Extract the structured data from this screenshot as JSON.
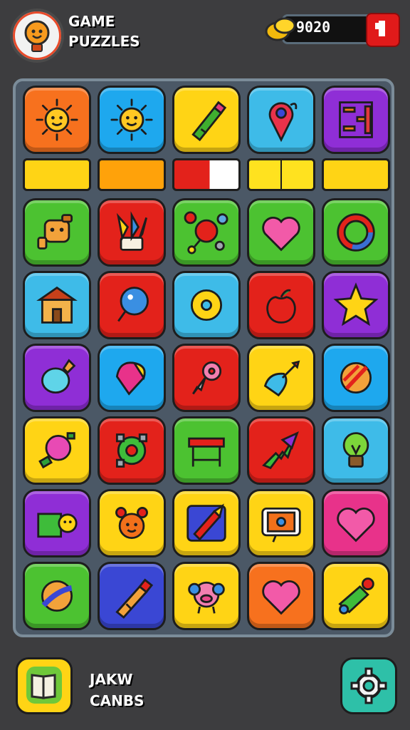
{
  "header": {
    "title_line1": "GAME",
    "title_line2": "PUZZLES",
    "coins": "9020",
    "logo_icon": "lightbulb-face-icon",
    "coin_icon": "gold-coins-icon",
    "add_icon": "plus-icon"
  },
  "colors": {
    "background": "#3d3d3f",
    "board": "#4b5866",
    "orange": "#f7711e",
    "blue": "#1ea8ee",
    "yellow": "#ffd415",
    "teal": "#3ebbe8",
    "purple": "#8f2ed6",
    "green": "#4cc231",
    "red": "#e3221b",
    "pink": "#e8328a",
    "royal": "#3a47d4"
  },
  "strips": [
    "yellow",
    "orange",
    "red-white",
    "yellow-split",
    "yellow"
  ],
  "rows": [
    [
      {
        "bg": "orange",
        "icon": "sun-icon"
      },
      {
        "bg": "blue",
        "icon": "sun-icon"
      },
      {
        "bg": "yellow",
        "icon": "paint-tube-icon"
      },
      {
        "bg": "teal",
        "icon": "map-pin-icon"
      },
      {
        "bg": "purple",
        "icon": "abacus-icon"
      }
    ],
    [
      {
        "bg": "green",
        "icon": "robot-icon"
      },
      {
        "bg": "red",
        "icon": "paintbrushes-icon"
      },
      {
        "bg": "green",
        "icon": "molecule-icon"
      },
      {
        "bg": "green",
        "icon": "heart-icon"
      },
      {
        "bg": "green",
        "icon": "ring-icon"
      }
    ],
    [
      {
        "bg": "teal",
        "icon": "house-icon"
      },
      {
        "bg": "red",
        "icon": "balloon-icon"
      },
      {
        "bg": "teal",
        "icon": "donut-icon"
      },
      {
        "bg": "red",
        "icon": "apple-icon"
      },
      {
        "bg": "purple",
        "icon": "star-icon"
      }
    ],
    [
      {
        "bg": "purple",
        "icon": "potion-icon"
      },
      {
        "bg": "blue",
        "icon": "kite-icon"
      },
      {
        "bg": "red",
        "icon": "key-icon"
      },
      {
        "bg": "yellow",
        "icon": "dart-icon"
      },
      {
        "bg": "blue",
        "icon": "striped-ball-icon"
      }
    ],
    [
      {
        "bg": "yellow",
        "icon": "candy-icon"
      },
      {
        "bg": "red",
        "icon": "gear-ring-icon"
      },
      {
        "bg": "green",
        "icon": "table-icon"
      },
      {
        "bg": "red",
        "icon": "arrow-icon"
      },
      {
        "bg": "teal",
        "icon": "lightbulb-icon"
      }
    ],
    [
      {
        "bg": "purple",
        "icon": "cube-smile-icon"
      },
      {
        "bg": "yellow",
        "icon": "bear-icon"
      },
      {
        "bg": "yellow",
        "icon": "pencil-icon"
      },
      {
        "bg": "yellow",
        "icon": "tv-icon"
      },
      {
        "bg": "pink",
        "icon": "heart-icon"
      }
    ],
    [
      {
        "bg": "green",
        "icon": "planet-ball-icon"
      },
      {
        "bg": "royal",
        "icon": "crayon-icon"
      },
      {
        "bg": "yellow",
        "icon": "pig-icon"
      },
      {
        "bg": "orange",
        "icon": "heart-icon"
      },
      {
        "bg": "yellow",
        "icon": "paint-bottle-icon"
      }
    ]
  ],
  "footer": {
    "label_line1": "JAKW",
    "label_line2": "CANBS",
    "book_icon": "open-book-icon",
    "settings_icon": "gear-icon"
  }
}
